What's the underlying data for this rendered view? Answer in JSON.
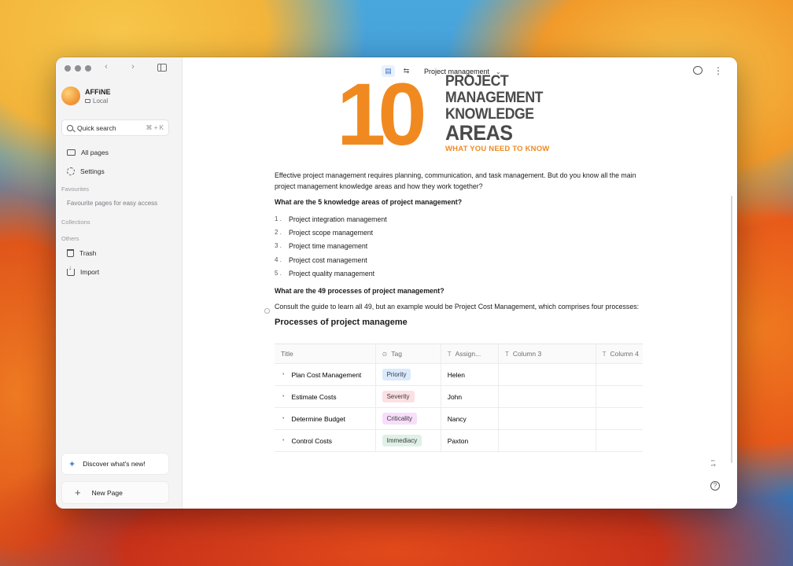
{
  "sidebar": {
    "workspace": {
      "name": "AFFiNE",
      "location": "Local"
    },
    "search": {
      "label": "Quick search",
      "shortcut": "⌘ + K"
    },
    "nav": [
      {
        "label": "All pages",
        "icon": "folder-icon"
      },
      {
        "label": "Settings",
        "icon": "gear-icon"
      }
    ],
    "favourites": {
      "label": "Favourites",
      "empty": "Favourite pages for easy access"
    },
    "collections": {
      "label": "Collections"
    },
    "others": {
      "label": "Others",
      "items": [
        {
          "label": "Trash",
          "icon": "trash-icon"
        },
        {
          "label": "Import",
          "icon": "import-icon"
        }
      ]
    },
    "discover": "Discover what's new!",
    "new_page": "New Page"
  },
  "topbar": {
    "title": "Project management"
  },
  "hero": {
    "number": "10",
    "words": [
      "PROJECT",
      "MANAGEMENT",
      "KNOWLEDGE",
      "AREAS"
    ],
    "subtitle": "WHAT YOU NEED TO KNOW"
  },
  "doc": {
    "intro": "Effective project management requires planning, communication, and task management. But do you know all the main project management knowledge areas and how they work together?",
    "q1": "What are the 5 knowledge areas of project management?",
    "areas": [
      {
        "num": "1 .",
        "text": "Project integration management"
      },
      {
        "num": "2 .",
        "text": "Project scope management"
      },
      {
        "num": "3 .",
        "text": "Project time management"
      },
      {
        "num": "4 .",
        "text": "Project cost management"
      },
      {
        "num": "5 .",
        "text": "Project quality management"
      }
    ],
    "q2": "What are the 49 processes of project management?",
    "consult": "Consult the guide to learn all 49, but an example would be Project Cost Management, which comprises four processes:",
    "table_title": "Processes of project manageme"
  },
  "table": {
    "headers": [
      "Title",
      "Tag",
      "Assign...",
      "Column 3",
      "Column 4"
    ],
    "rows": [
      {
        "title": "Plan Cost Management",
        "tag": "Priority",
        "tag_color": "#dbeafd",
        "assignee": "Helen"
      },
      {
        "title": "Estimate Costs",
        "tag": "Severity",
        "tag_color": "#fde0e3",
        "assignee": "John"
      },
      {
        "title": "Determine Budget",
        "tag": "Criticality",
        "tag_color": "#f8defa",
        "assignee": "Nancy"
      },
      {
        "title": "Control Costs",
        "tag": "Immediacy",
        "tag_color": "#dff1e6",
        "assignee": "Paxton"
      }
    ]
  },
  "colors": {
    "accent": "#f08a20",
    "brand_blue": "#3a6fd1"
  }
}
